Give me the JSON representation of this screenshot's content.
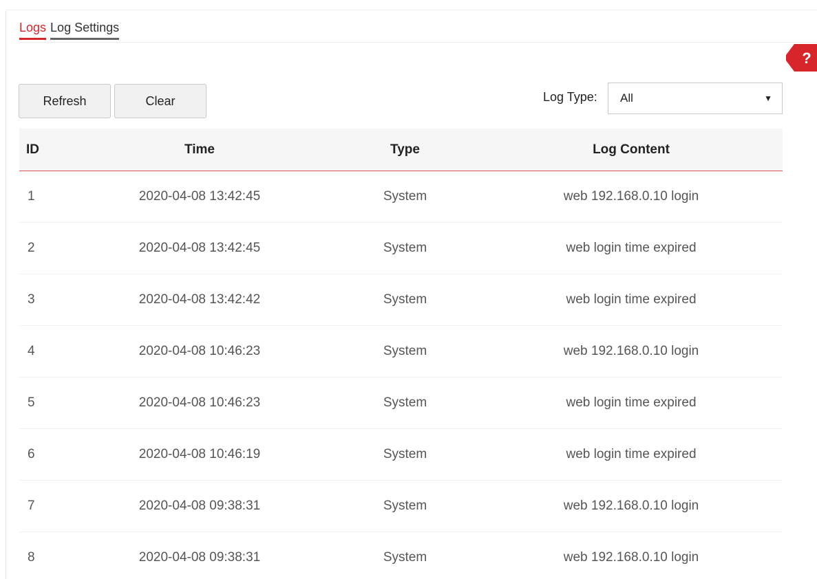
{
  "tabs": [
    {
      "label": "Logs",
      "active": true
    },
    {
      "label": "Log Settings",
      "active": false
    }
  ],
  "help": {
    "label": "?",
    "color": "#d7262b"
  },
  "toolbar": {
    "refresh_label": "Refresh",
    "clear_label": "Clear"
  },
  "log_type": {
    "label": "Log Type:",
    "selected": "All"
  },
  "table": {
    "headers": {
      "id": "ID",
      "time": "Time",
      "type": "Type",
      "content": "Log Content"
    },
    "rows": [
      {
        "id": "1",
        "time": "2020-04-08 13:42:45",
        "type": "System",
        "content": "web 192.168.0.10 login"
      },
      {
        "id": "2",
        "time": "2020-04-08 13:42:45",
        "type": "System",
        "content": "web login time expired"
      },
      {
        "id": "3",
        "time": "2020-04-08 13:42:42",
        "type": "System",
        "content": "web login time expired"
      },
      {
        "id": "4",
        "time": "2020-04-08 10:46:23",
        "type": "System",
        "content": "web 192.168.0.10 login"
      },
      {
        "id": "5",
        "time": "2020-04-08 10:46:23",
        "type": "System",
        "content": "web login time expired"
      },
      {
        "id": "6",
        "time": "2020-04-08 10:46:19",
        "type": "System",
        "content": "web login time expired"
      },
      {
        "id": "7",
        "time": "2020-04-08 09:38:31",
        "type": "System",
        "content": "web 192.168.0.10 login"
      },
      {
        "id": "8",
        "time": "2020-04-08 09:38:31",
        "type": "System",
        "content": "web 192.168.0.10 login"
      }
    ]
  },
  "colors": {
    "accent": "#d7262b",
    "header_bg": "#f6f6f6",
    "button_bg": "#f1f1f1"
  }
}
